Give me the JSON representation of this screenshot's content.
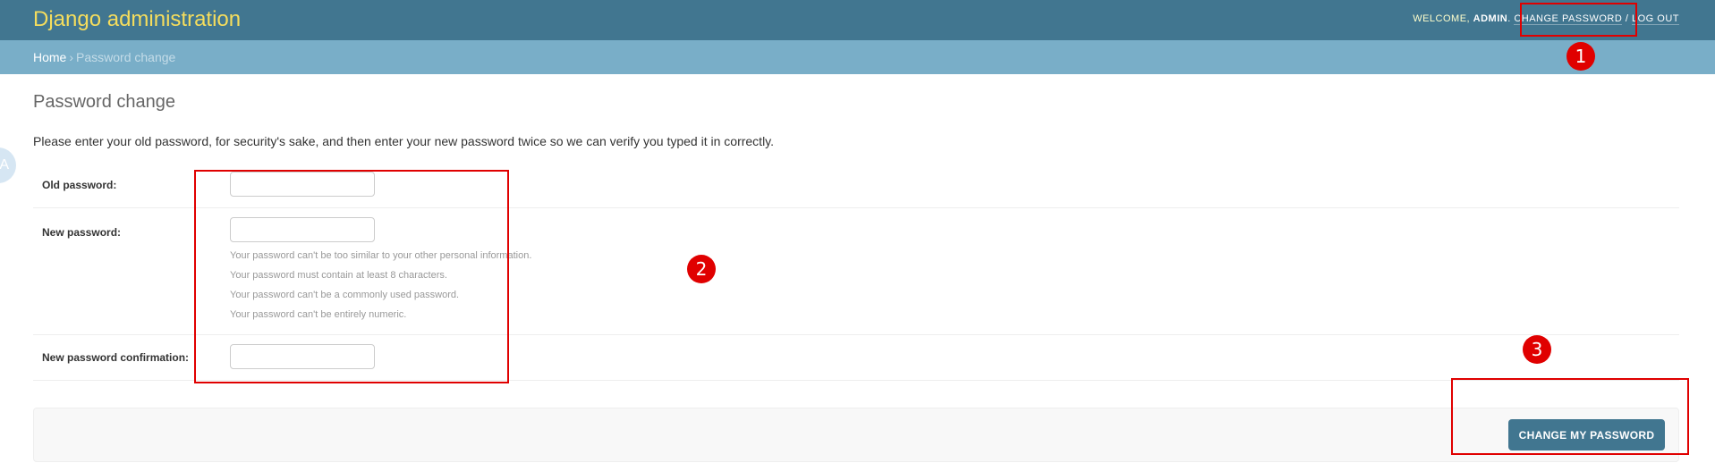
{
  "header": {
    "branding": "Django administration",
    "welcome": "WELCOME, ",
    "username": "ADMIN",
    "change_password": "CHANGE PASSWORD",
    "separator": " / ",
    "logout": "LOG OUT"
  },
  "breadcrumbs": {
    "home": "Home",
    "separator": "›",
    "current": "Password change"
  },
  "page": {
    "title": "Password change",
    "intro": "Please enter your old password, for security's sake, and then enter your new password twice so we can verify you typed it in correctly.",
    "side_badge": "A"
  },
  "form": {
    "old_password_label": "Old password:",
    "old_password_value": "",
    "new_password_label": "New password:",
    "new_password_value": "",
    "help": [
      "Your password can't be too similar to your other personal information.",
      "Your password must contain at least 8 characters.",
      "Your password can't be a commonly used password.",
      "Your password can't be entirely numeric."
    ],
    "confirm_label": "New password confirmation:",
    "confirm_value": ""
  },
  "submit": {
    "label": "CHANGE MY PASSWORD"
  },
  "annotations": [
    "1",
    "2",
    "3"
  ],
  "colors": {
    "header_bg": "#417690",
    "breadcrumbs_bg": "#79aec8",
    "branding": "#f5dd5d",
    "annotation": "#e00000"
  }
}
